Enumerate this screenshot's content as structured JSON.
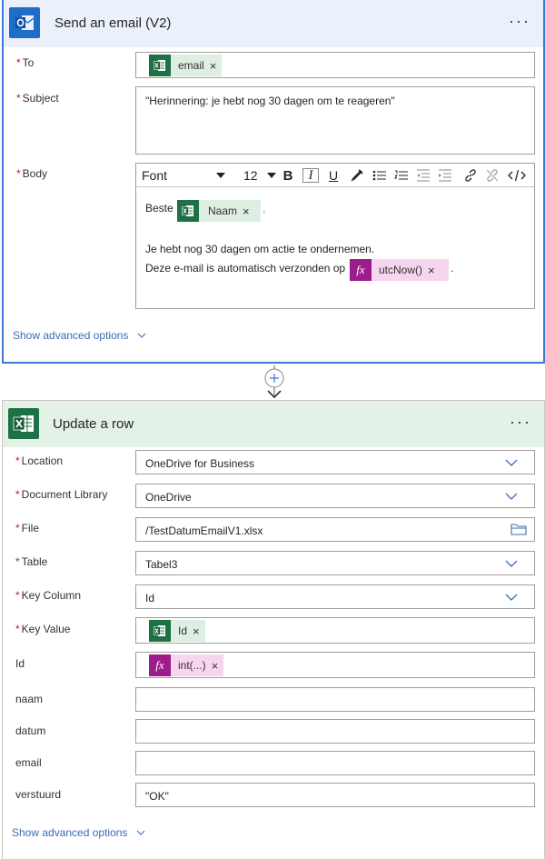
{
  "email_card": {
    "title": "Send an email (V2)",
    "more": "···",
    "to": {
      "label": "To",
      "token": "email"
    },
    "subject": {
      "label": "Subject",
      "value": "\"Herinnering: je hebt nog 30 dagen om te reageren\""
    },
    "body": {
      "label": "Body",
      "toolbar": {
        "font": "Font",
        "size": "12",
        "bold": "B",
        "italic": "I",
        "underline": "U"
      },
      "line1_prefix": "Beste",
      "line1_token": "Naam",
      "line1_suffix": ",",
      "line2": "Je hebt nog 30 dagen om actie te ondernemen.",
      "line3_prefix": "Deze e-mail is automatisch verzonden op",
      "line3_token": "utcNow()",
      "line3_suffix": "."
    },
    "advanced": "Show advanced options"
  },
  "update_card": {
    "title": "Update a row",
    "more": "···",
    "fields": {
      "location": {
        "label": "Location",
        "value": "OneDrive for Business"
      },
      "library": {
        "label": "Document Library",
        "value": "OneDrive"
      },
      "file": {
        "label": "File",
        "value": "/TestDatumEmailV1.xlsx"
      },
      "table": {
        "label": "Table",
        "value": "Tabel3"
      },
      "key_column": {
        "label": "Key Column",
        "value": "Id"
      },
      "key_value": {
        "label": "Key Value",
        "token": "Id"
      },
      "id": {
        "label": "Id",
        "token": "int(...)"
      },
      "naam": {
        "label": "naam",
        "value": ""
      },
      "datum": {
        "label": "datum",
        "value": ""
      },
      "email": {
        "label": "email",
        "value": ""
      },
      "verstuurd": {
        "label": "verstuurd",
        "value": "\"OK\""
      }
    },
    "advanced": "Show advanced options"
  },
  "token_remove": "×",
  "required_mark": "*",
  "icons": {
    "app_outlook": "outlook-icon",
    "app_excel": "excel-icon",
    "token_excel": "excel-token-icon",
    "token_fx": "fx-icon",
    "connector": "add-step-icon"
  },
  "colors": {
    "outlook_blue": "#1f6cc9",
    "excel_green": "#1e7145",
    "fx_purple": "#9c1c8c",
    "link": "#3b6bb6",
    "required": "#a4262c"
  }
}
